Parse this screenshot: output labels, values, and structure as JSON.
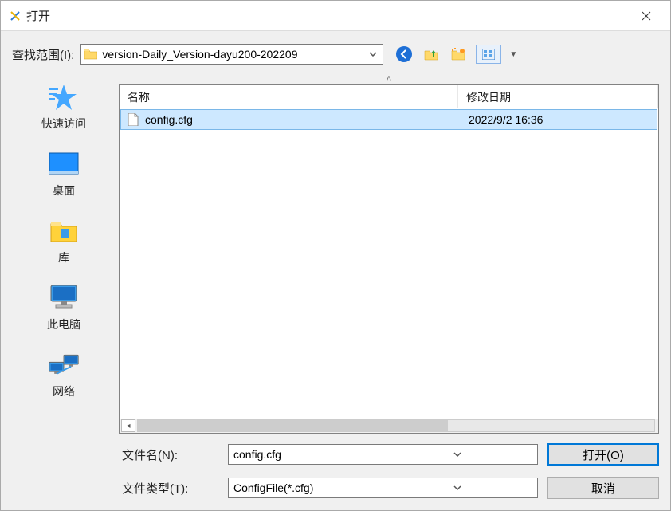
{
  "window": {
    "title": "打开"
  },
  "lookin": {
    "label": "查找范围(I):",
    "value": "version-Daily_Version-dayu200-202209"
  },
  "places": [
    {
      "label": "快速访问"
    },
    {
      "label": "桌面"
    },
    {
      "label": "库"
    },
    {
      "label": "此电脑"
    },
    {
      "label": "网络"
    }
  ],
  "columns": {
    "name": "名称",
    "date": "修改日期"
  },
  "files": [
    {
      "name": "config.cfg",
      "date": "2022/9/2 16:36"
    }
  ],
  "filename": {
    "label": "文件名(N):",
    "value": "config.cfg"
  },
  "filetype": {
    "label": "文件类型(T):",
    "value": "ConfigFile(*.cfg)"
  },
  "buttons": {
    "open": "打开(O)",
    "cancel": "取消"
  }
}
